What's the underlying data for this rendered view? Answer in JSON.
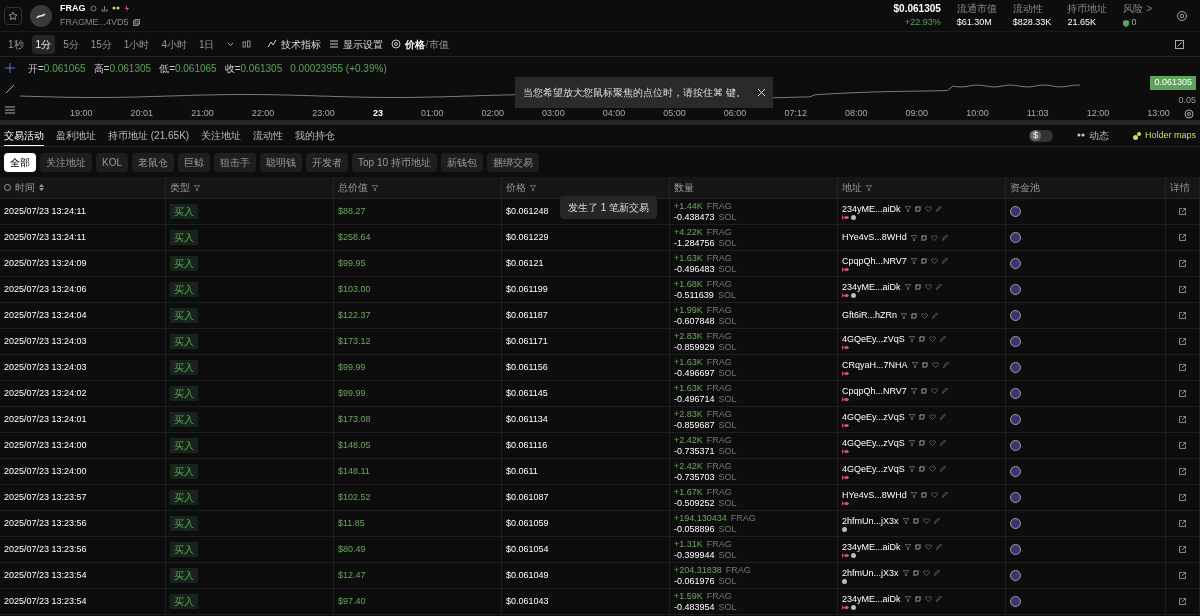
{
  "token": {
    "symbol": "FRAG",
    "address": "FRAGME...4VD5"
  },
  "price": {
    "value": "$0.061305",
    "change": "+22.93%"
  },
  "stats": [
    {
      "label": "流通市值",
      "value": "$61.30M"
    },
    {
      "label": "流动性",
      "value": "$828.33K"
    },
    {
      "label": "持币地址",
      "value": "21.65K"
    },
    {
      "label": "风险 >",
      "value": "0",
      "kind": "risk"
    }
  ],
  "intervals": [
    {
      "label": "1秒",
      "selected": false
    },
    {
      "label": "1分",
      "selected": true
    },
    {
      "label": "5分",
      "selected": false
    },
    {
      "label": "15分",
      "selected": false
    },
    {
      "label": "1小时",
      "selected": false
    },
    {
      "label": "4小时",
      "selected": false
    },
    {
      "label": "1日",
      "selected": false
    }
  ],
  "toolbar": [
    {
      "label": "技术指标",
      "kind": "indicator"
    },
    {
      "label": "显示设置",
      "kind": "display"
    }
  ],
  "price_toggle_separator": "/",
  "price_toggle": [
    {
      "label": "价格",
      "selected": true
    },
    {
      "label": "市值",
      "selected": false
    }
  ],
  "chart": {
    "ohlc": [
      {
        "label": "开=",
        "value": "0.061065"
      },
      {
        "label": "高=",
        "value": "0.061305"
      },
      {
        "label": "低=",
        "value": "0.061065"
      },
      {
        "label": "收=",
        "value": "0.061305"
      }
    ],
    "change": "0.00023955 (+0.39%)",
    "last_price": "0.061305",
    "scale_label": "0.05",
    "times": [
      {
        "label": "19:00",
        "bold": false
      },
      {
        "label": "20:01",
        "bold": false
      },
      {
        "label": "21:00",
        "bold": false
      },
      {
        "label": "22:00",
        "bold": false
      },
      {
        "label": "23:00",
        "bold": false
      },
      {
        "label": "23",
        "bold": true
      },
      {
        "label": "01:00",
        "bold": false
      },
      {
        "label": "02:00",
        "bold": false
      },
      {
        "label": "03:00",
        "bold": false
      },
      {
        "label": "04:00",
        "bold": false
      },
      {
        "label": "05:00",
        "bold": false
      },
      {
        "label": "06:00",
        "bold": false
      },
      {
        "label": "07:12",
        "bold": false
      },
      {
        "label": "08:00",
        "bold": false
      },
      {
        "label": "09:00",
        "bold": false
      },
      {
        "label": "10:00",
        "bold": false
      },
      {
        "label": "11:03",
        "bold": false
      },
      {
        "label": "12:00",
        "bold": false
      },
      {
        "label": "13:00",
        "bold": false
      }
    ],
    "hint": "当您希望放大您鼠标聚焦的点位时，请按住⌘ 键。"
  },
  "tabs": [
    {
      "label": "交易活动",
      "selected": true
    },
    {
      "label": "盈利地址",
      "selected": false
    },
    {
      "label": "持币地址 (21.65K)",
      "selected": false
    },
    {
      "label": "关注地址",
      "selected": false
    },
    {
      "label": "流动性",
      "selected": false
    },
    {
      "label": "我的持仓",
      "selected": false
    }
  ],
  "tab_actions": [
    {
      "label": "$",
      "kind": "toggle"
    },
    {
      "label": "动态",
      "kind": "activity"
    },
    {
      "label": "Holder maps",
      "kind": "holder"
    }
  ],
  "filters": [
    {
      "label": "全部",
      "selected": true
    },
    {
      "label": "关注地址",
      "selected": false
    },
    {
      "label": "KOL",
      "selected": false
    },
    {
      "label": "老鼠仓",
      "selected": false
    },
    {
      "label": "巨鲸",
      "selected": false
    },
    {
      "label": "狙击手",
      "selected": false
    },
    {
      "label": "聪明钱",
      "selected": false
    },
    {
      "label": "开发者",
      "selected": false
    },
    {
      "label": "Top 10 持币地址",
      "selected": false
    },
    {
      "label": "新钱包",
      "selected": false
    },
    {
      "label": "捆绑交易",
      "selected": false
    }
  ],
  "table": {
    "columns": [
      "时间",
      "类型",
      "总价值",
      "价格",
      "数量",
      "地址",
      "资金池",
      "详情"
    ],
    "toast": "发生了 1 笔新交易",
    "rows": [
      {
        "time": "2025/07/23 13:24:11",
        "type": "买入",
        "value": "$88.27",
        "price": "$0.061248",
        "amount": "+1.44K",
        "token": "FRAG",
        "sol": "-0.438473",
        "unit": "SOL",
        "address": "234yME...aiDk",
        "badges": [
          {
            "kind": "fish"
          },
          {
            "kind": "coin"
          }
        ]
      },
      {
        "time": "2025/07/23 13:24:11",
        "type": "买入",
        "value": "$258.64",
        "price": "$0.061229",
        "amount": "+4.22K",
        "token": "FRAG",
        "sol": "-1.284756",
        "unit": "SOL",
        "address": "HYe4vS...8WHd"
      },
      {
        "time": "2025/07/23 13:24:09",
        "type": "买入",
        "value": "$99.95",
        "price": "$0.06121",
        "amount": "+1.63K",
        "token": "FRAG",
        "sol": "-0.496483",
        "unit": "SOL",
        "address": "CpqpQh...NRV7",
        "badges": [
          {
            "kind": "fish"
          }
        ]
      },
      {
        "time": "2025/07/23 13:24:06",
        "type": "买入",
        "value": "$103.00",
        "price": "$0.061199",
        "amount": "+1.68K",
        "token": "FRAG",
        "sol": "-0.511639",
        "unit": "SOL",
        "address": "234yME...aiDk",
        "badges": [
          {
            "kind": "fish"
          },
          {
            "kind": "coin"
          }
        ]
      },
      {
        "time": "2025/07/23 13:24:04",
        "type": "买入",
        "value": "$122.37",
        "price": "$0.061187",
        "amount": "+1.99K",
        "token": "FRAG",
        "sol": "-0.607848",
        "unit": "SOL",
        "address": "Gft6iR...hZRn"
      },
      {
        "time": "2025/07/23 13:24:03",
        "type": "买入",
        "value": "$173.12",
        "price": "$0.061171",
        "amount": "+2.83K",
        "token": "FRAG",
        "sol": "-0.859929",
        "unit": "SOL",
        "address": "4GQeEy...zVqS",
        "badges": [
          {
            "kind": "fish"
          }
        ]
      },
      {
        "time": "2025/07/23 13:24:03",
        "type": "买入",
        "value": "$99.99",
        "price": "$0.061156",
        "amount": "+1.63K",
        "token": "FRAG",
        "sol": "-0.496697",
        "unit": "SOL",
        "address": "CRqyaH...7NHA",
        "badges": [
          {
            "kind": "fish"
          }
        ]
      },
      {
        "time": "2025/07/23 13:24:02",
        "type": "买入",
        "value": "$99.99",
        "price": "$0.061145",
        "amount": "+1.63K",
        "token": "FRAG",
        "sol": "-0.496714",
        "unit": "SOL",
        "address": "CpqpQh...NRV7",
        "badges": [
          {
            "kind": "fish"
          }
        ]
      },
      {
        "time": "2025/07/23 13:24:01",
        "type": "买入",
        "value": "$173.08",
        "price": "$0.061134",
        "amount": "+2.83K",
        "token": "FRAG",
        "sol": "-0.859687",
        "unit": "SOL",
        "address": "4GQeEy...zVqS",
        "badges": [
          {
            "kind": "fish"
          }
        ]
      },
      {
        "time": "2025/07/23 13:24:00",
        "type": "买入",
        "value": "$148.05",
        "price": "$0.061116",
        "amount": "+2.42K",
        "token": "FRAG",
        "sol": "-0.735371",
        "unit": "SOL",
        "address": "4GQeEy...zVqS",
        "badges": [
          {
            "kind": "fish"
          }
        ]
      },
      {
        "time": "2025/07/23 13:24:00",
        "type": "买入",
        "value": "$148.11",
        "price": "$0.0611",
        "amount": "+2.42K",
        "token": "FRAG",
        "sol": "-0.735703",
        "unit": "SOL",
        "address": "4GQeEy...zVqS",
        "badges": [
          {
            "kind": "fish"
          }
        ]
      },
      {
        "time": "2025/07/23 13:23:57",
        "type": "买入",
        "value": "$102.52",
        "price": "$0.061087",
        "amount": "+1.67K",
        "token": "FRAG",
        "sol": "-0.509252",
        "unit": "SOL",
        "address": "HYe4vS...8WHd",
        "badges": [
          {
            "kind": "fish"
          }
        ]
      },
      {
        "time": "2025/07/23 13:23:56",
        "type": "买入",
        "value": "$11.85",
        "price": "$0.061059",
        "amount": "+194.130434",
        "token": "FRAG",
        "sol": "-0.058896",
        "unit": "SOL",
        "address": "2hfmUn...jX3x",
        "badges": [
          {
            "kind": "coin"
          }
        ]
      },
      {
        "time": "2025/07/23 13:23:56",
        "type": "买入",
        "value": "$80.49",
        "price": "$0.061054",
        "amount": "+1.31K",
        "token": "FRAG",
        "sol": "-0.399944",
        "unit": "SOL",
        "address": "234yME...aiDk",
        "badges": [
          {
            "kind": "fish"
          },
          {
            "kind": "coin"
          }
        ]
      },
      {
        "time": "2025/07/23 13:23:54",
        "type": "买入",
        "value": "$12.47",
        "price": "$0.061049",
        "amount": "+204.31838",
        "token": "FRAG",
        "sol": "-0.061976",
        "unit": "SOL",
        "address": "2hfmUn...jX3x",
        "badges": [
          {
            "kind": "coin"
          }
        ]
      },
      {
        "time": "2025/07/23 13:23:54",
        "type": "买入",
        "value": "$97.40",
        "price": "$0.061043",
        "amount": "+1.59K",
        "token": "FRAG",
        "sol": "-0.483954",
        "unit": "SOL",
        "address": "234yME...aiDk",
        "badges": [
          {
            "kind": "fish"
          },
          {
            "kind": "coin"
          }
        ]
      }
    ]
  }
}
